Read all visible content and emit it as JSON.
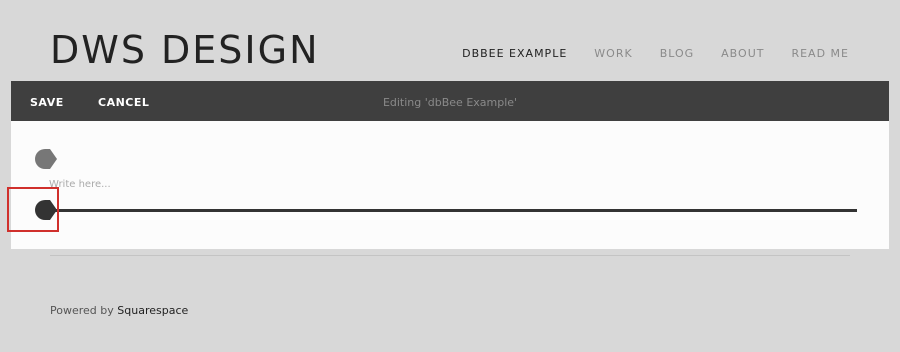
{
  "site": {
    "title": "DWS DESIGN"
  },
  "nav": {
    "items": [
      {
        "label": "DBBEE EXAMPLE",
        "active": true
      },
      {
        "label": "WORK"
      },
      {
        "label": "BLOG"
      },
      {
        "label": "ABOUT"
      },
      {
        "label": "READ ME"
      }
    ]
  },
  "editor_bar": {
    "save_label": "SAVE",
    "cancel_label": "CANCEL",
    "status_text": "Editing 'dbBee Example'"
  },
  "editor": {
    "placeholder": "Write here..."
  },
  "footer": {
    "prefix": "Powered by ",
    "link_text": "Squarespace"
  },
  "colors": {
    "background": "#d8d8d8",
    "toolbar": "#3f3f3f",
    "editor_background": "#fcfcfc",
    "highlight": "#d0302c"
  }
}
